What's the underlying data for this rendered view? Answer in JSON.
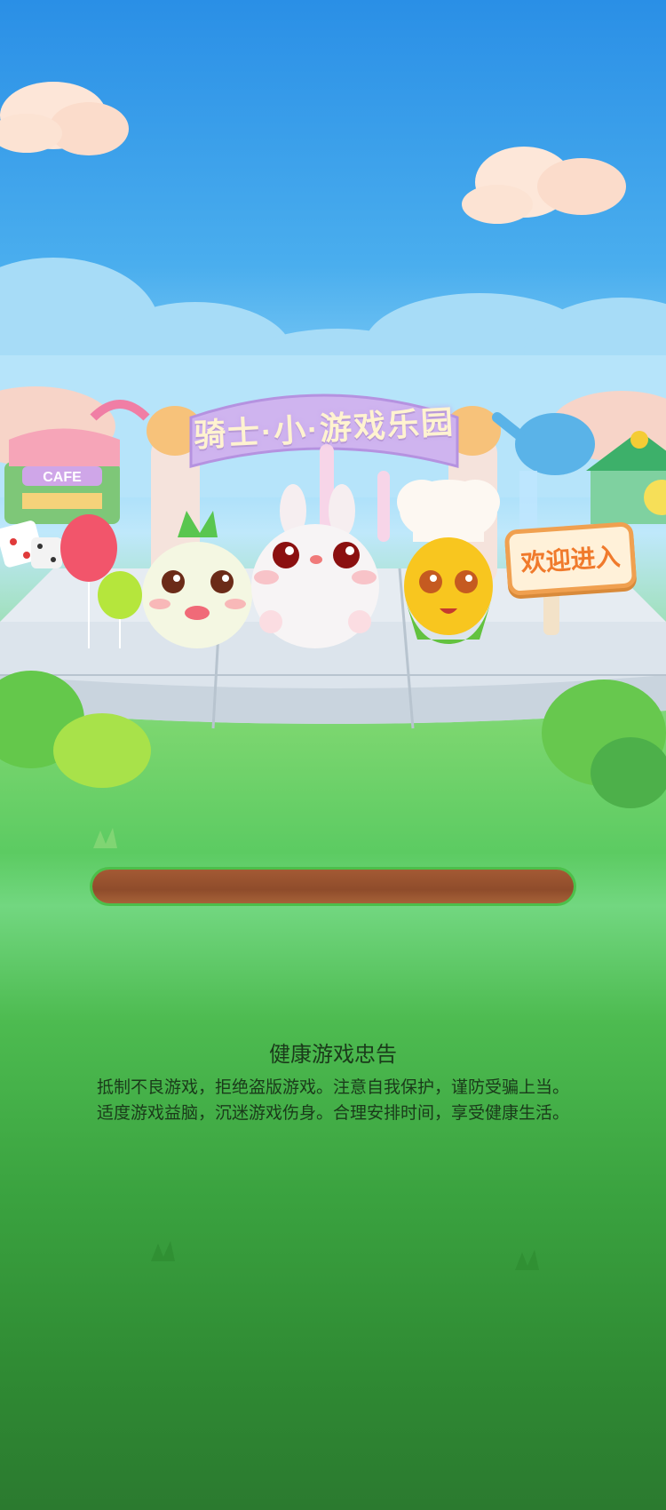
{
  "scene": {
    "arch_title": "骑士·小·游戏乐园",
    "cafe_sign": "CAFE",
    "welcome_button": "欢迎进入"
  },
  "loading": {
    "progress": 0
  },
  "notice": {
    "title": "健康游戏忠告",
    "line1": "抵制不良游戏，拒绝盗版游戏。注意自我保护，谨防受骗上当。",
    "line2": "适度游戏益脑，沉迷游戏伤身。合理安排时间，享受健康生活。"
  },
  "colors": {
    "sky_top": "#2a8fe6",
    "grass": "#5ccb62",
    "progress_track": "#8f4c2b",
    "arch": "#cfb4ef",
    "sign_border": "#f0a050"
  },
  "icons": [
    "radish-character",
    "bunny-character",
    "corn-chef-character",
    "balloon",
    "dice",
    "cafe-stall",
    "carousel",
    "watering-can"
  ]
}
